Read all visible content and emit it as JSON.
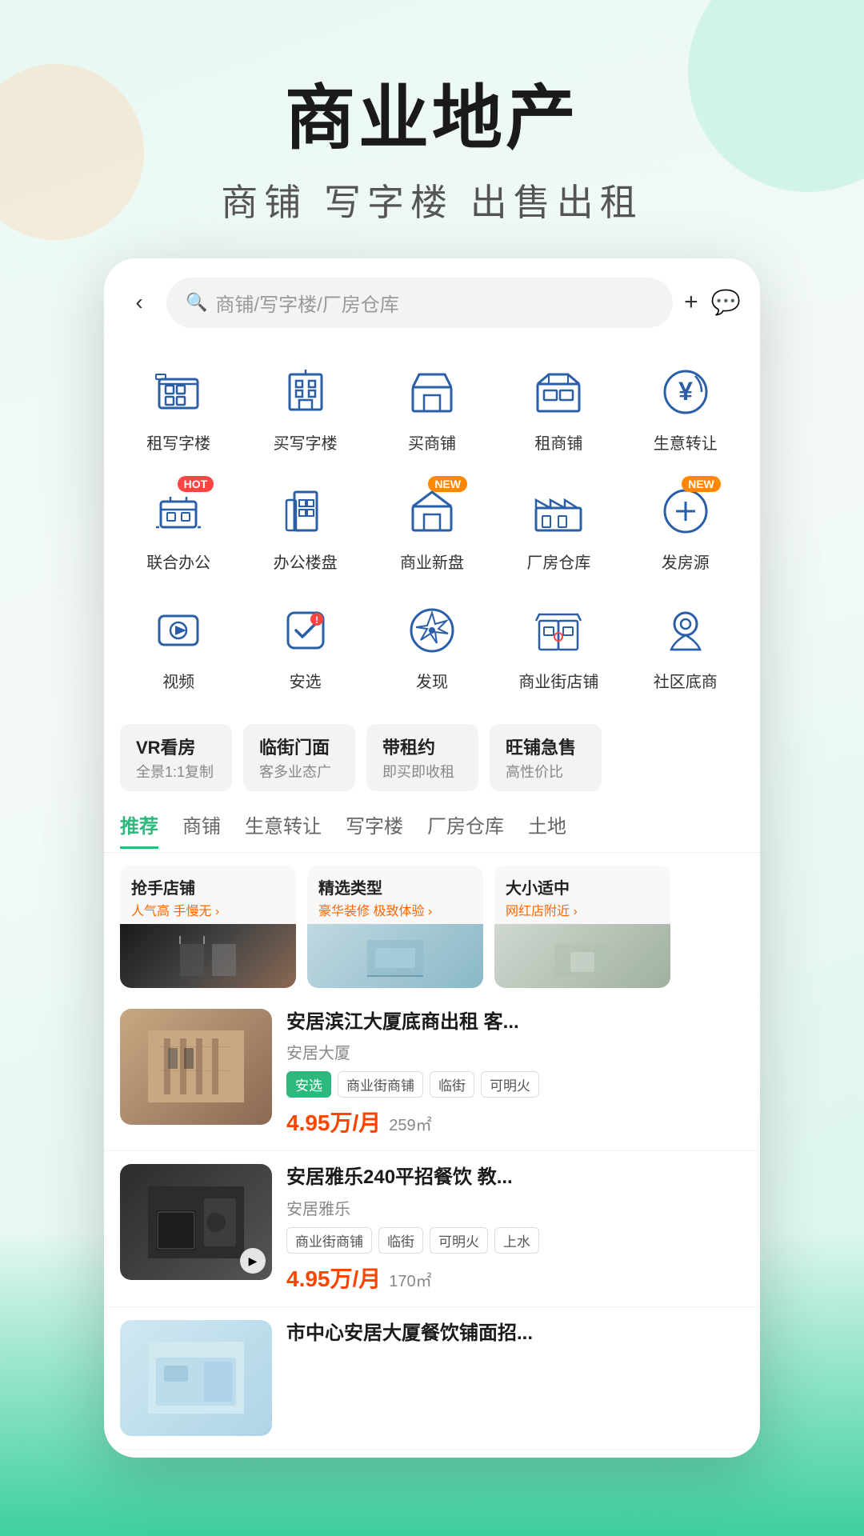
{
  "page": {
    "background": {
      "main_title": "商业地产",
      "sub_title": "商铺  写字楼  出售出租"
    },
    "topbar": {
      "back_label": "‹",
      "search_placeholder": "商铺/写字楼/厂房仓库",
      "add_label": "+",
      "message_label": "💬"
    },
    "icon_grid": {
      "rows": [
        [
          {
            "id": "rent-office",
            "label": "租写字楼",
            "badge": null,
            "icon": "office-rent"
          },
          {
            "id": "buy-office",
            "label": "买写字楼",
            "badge": null,
            "icon": "office-buy"
          },
          {
            "id": "buy-shop",
            "label": "买商铺",
            "badge": null,
            "icon": "shop-buy"
          },
          {
            "id": "rent-shop",
            "label": "租商铺",
            "badge": null,
            "icon": "shop-rent"
          },
          {
            "id": "transfer-biz",
            "label": "生意转让",
            "badge": null,
            "icon": "biz-transfer"
          }
        ],
        [
          {
            "id": "cowork",
            "label": "联合办公",
            "badge": "HOT",
            "badge_type": "hot",
            "icon": "cowork"
          },
          {
            "id": "office-list",
            "label": "办公楼盘",
            "badge": null,
            "icon": "office-list"
          },
          {
            "id": "new-commercial",
            "label": "商业新盘",
            "badge": "NEW",
            "badge_type": "new",
            "icon": "new-commercial"
          },
          {
            "id": "factory",
            "label": "厂房仓库",
            "badge": null,
            "icon": "factory"
          },
          {
            "id": "post-listing",
            "label": "发房源",
            "badge": "NEW",
            "badge_type": "new",
            "icon": "post-listing"
          }
        ],
        [
          {
            "id": "video",
            "label": "视频",
            "badge": null,
            "icon": "video"
          },
          {
            "id": "anxuan",
            "label": "安选",
            "badge": null,
            "icon": "anxuan"
          },
          {
            "id": "discover",
            "label": "发现",
            "badge": null,
            "icon": "discover"
          },
          {
            "id": "commercial-street",
            "label": "商业街店铺",
            "badge": null,
            "icon": "commercial-street"
          },
          {
            "id": "community-base",
            "label": "社区底商",
            "badge": null,
            "icon": "community-base"
          }
        ]
      ]
    },
    "tag_filters": [
      {
        "title": "VR看房",
        "sub": "全景1:1复制"
      },
      {
        "title": "临街门面",
        "sub": "客多业态广"
      },
      {
        "title": "带租约",
        "sub": "即买即收租"
      },
      {
        "title": "旺铺急售",
        "sub": "高性价比"
      }
    ],
    "tabs": [
      {
        "label": "推荐",
        "active": true
      },
      {
        "label": "商铺",
        "active": false
      },
      {
        "label": "生意转让",
        "active": false
      },
      {
        "label": "写字楼",
        "active": false
      },
      {
        "label": "厂房仓库",
        "active": false
      },
      {
        "label": "土地",
        "active": false
      }
    ],
    "featured_cards": [
      {
        "title": "抢手店铺",
        "sub": "人气高 手慢无 >",
        "sub_color": "#ff6600"
      },
      {
        "title": "精选类型",
        "sub": "豪华装修 极致体验 >",
        "sub_color": "#ff6600"
      },
      {
        "title": "大小适中",
        "sub": "网红店附近 >",
        "sub_color": "#ff6600"
      }
    ],
    "listings": [
      {
        "id": "listing-1",
        "title": "安居滨江大厦底商出租 客...",
        "address": "安居大厦",
        "tags": [
          {
            "label": "安选",
            "type": "green"
          },
          {
            "label": "商业街商铺",
            "type": "normal"
          },
          {
            "label": "临街",
            "type": "normal"
          },
          {
            "label": "可明火",
            "type": "normal"
          }
        ],
        "price": "4.95万/月",
        "area": "259㎡",
        "img_type": "clothing",
        "has_video": false
      },
      {
        "id": "listing-2",
        "title": "安居雅乐240平招餐饮 教...",
        "address": "安居雅乐",
        "tags": [
          {
            "label": "商业街商铺",
            "type": "normal"
          },
          {
            "label": "临街",
            "type": "normal"
          },
          {
            "label": "可明火",
            "type": "normal"
          },
          {
            "label": "上水",
            "type": "normal"
          }
        ],
        "price": "4.95万/月",
        "area": "170㎡",
        "img_type": "cafe",
        "has_video": true
      },
      {
        "id": "listing-3",
        "title": "市中心安居大厦餐饮铺面招...",
        "address": "",
        "tags": [],
        "price": "",
        "area": "",
        "img_type": "office",
        "has_video": false
      }
    ]
  }
}
